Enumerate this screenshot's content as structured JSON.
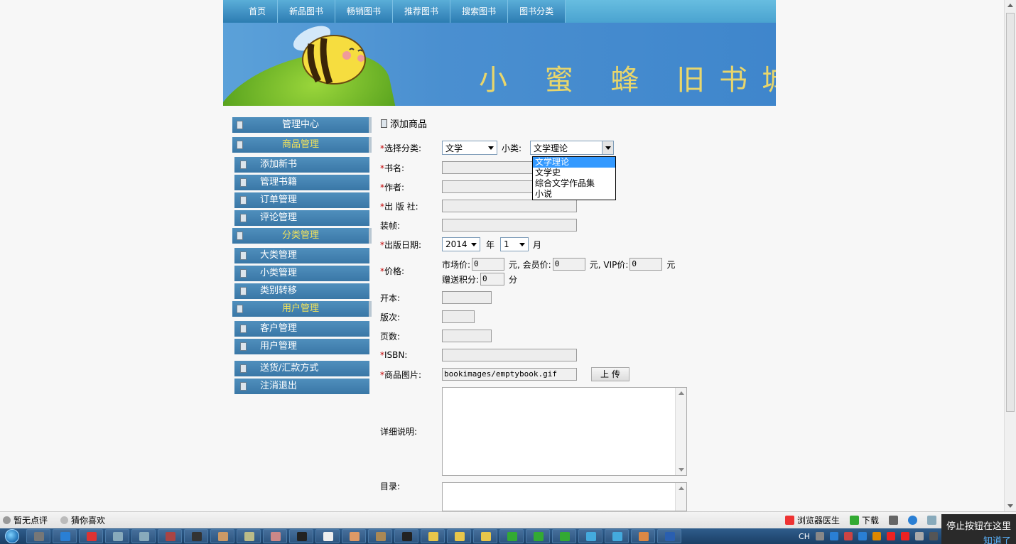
{
  "nav": {
    "items": [
      "首页",
      "新品图书",
      "畅销图书",
      "推荐图书",
      "搜索图书",
      "图书分类"
    ]
  },
  "banner": {
    "title": "小 蜜 蜂 旧书城"
  },
  "sidebar": {
    "head_admin": "管理中心",
    "head_goods": "商品管理",
    "goods_items": [
      "添加新书",
      "管理书籍",
      "订单管理",
      "评论管理"
    ],
    "head_category": "分类管理",
    "category_items": [
      "大类管理",
      "小类管理",
      "类别转移"
    ],
    "head_user": "用户管理",
    "user_items": [
      "客户管理",
      "用户管理"
    ],
    "extra_items": [
      "送货/汇款方式",
      "注消退出"
    ]
  },
  "form": {
    "title": "添加商品",
    "category_label": "选择分类:",
    "category_value": "文学",
    "subcategory_label": "小类:",
    "subcategory_value": "文学理论",
    "subcategory_options": [
      "文学理论",
      "文学史",
      "综合文学作品集",
      "小说"
    ],
    "bookname_label": "书名:",
    "author_label": "作者:",
    "publisher_label": "出 版 社:",
    "binding_label": "装帧:",
    "pubdate_label": "出版日期:",
    "year_value": "2014",
    "year_unit": "年",
    "month_value": "1",
    "month_unit": "月",
    "price_label": "价格:",
    "market_price_label": "市场价:",
    "market_price_value": "0",
    "member_price_label": "元, 会员价:",
    "member_price_value": "0",
    "vip_price_label": "元, VIP价:",
    "vip_price_value": "0",
    "yuan": "元",
    "points_label": "赠送积分:",
    "points_value": "0",
    "points_unit": "分",
    "format_label": "开本:",
    "edition_label": "版次:",
    "pages_label": "页数:",
    "isbn_label": "ISBN:",
    "image_label": "商品图片:",
    "image_value": "bookimages/emptybook.gif",
    "upload_label": "上 传",
    "detail_label": "详细说明:",
    "toc_label": "目录:",
    "required_mark": "*"
  },
  "statusbar": {
    "no_review": "暂无点评",
    "guess": "猜你喜欢",
    "doctor": "浏览器医生",
    "download": "下载"
  },
  "taskbar": {
    "lang": "CH"
  },
  "notice": {
    "text": "停止按钮在这里",
    "link": "知道了"
  }
}
